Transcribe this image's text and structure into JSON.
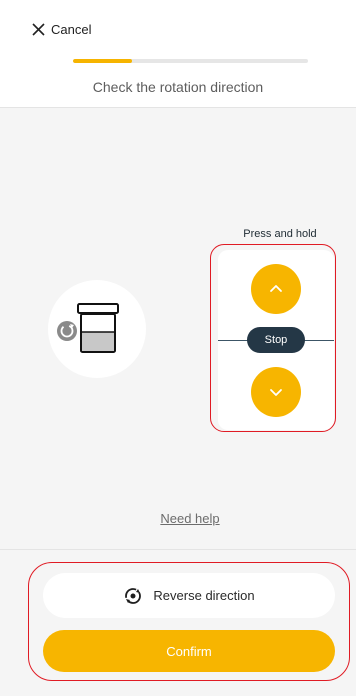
{
  "header": {
    "cancel_label": "Cancel",
    "progress": 0.25,
    "subtitle": "Check the rotation direction"
  },
  "controls": {
    "press_hold_label": "Press and hold",
    "stop_label": "Stop"
  },
  "help": {
    "link_label": "Need help"
  },
  "footer": {
    "reverse_label": "Reverse direction",
    "confirm_label": "Confirm"
  },
  "colors": {
    "accent": "#f7b500",
    "dark": "#243746",
    "annotation": "#e01b24"
  }
}
